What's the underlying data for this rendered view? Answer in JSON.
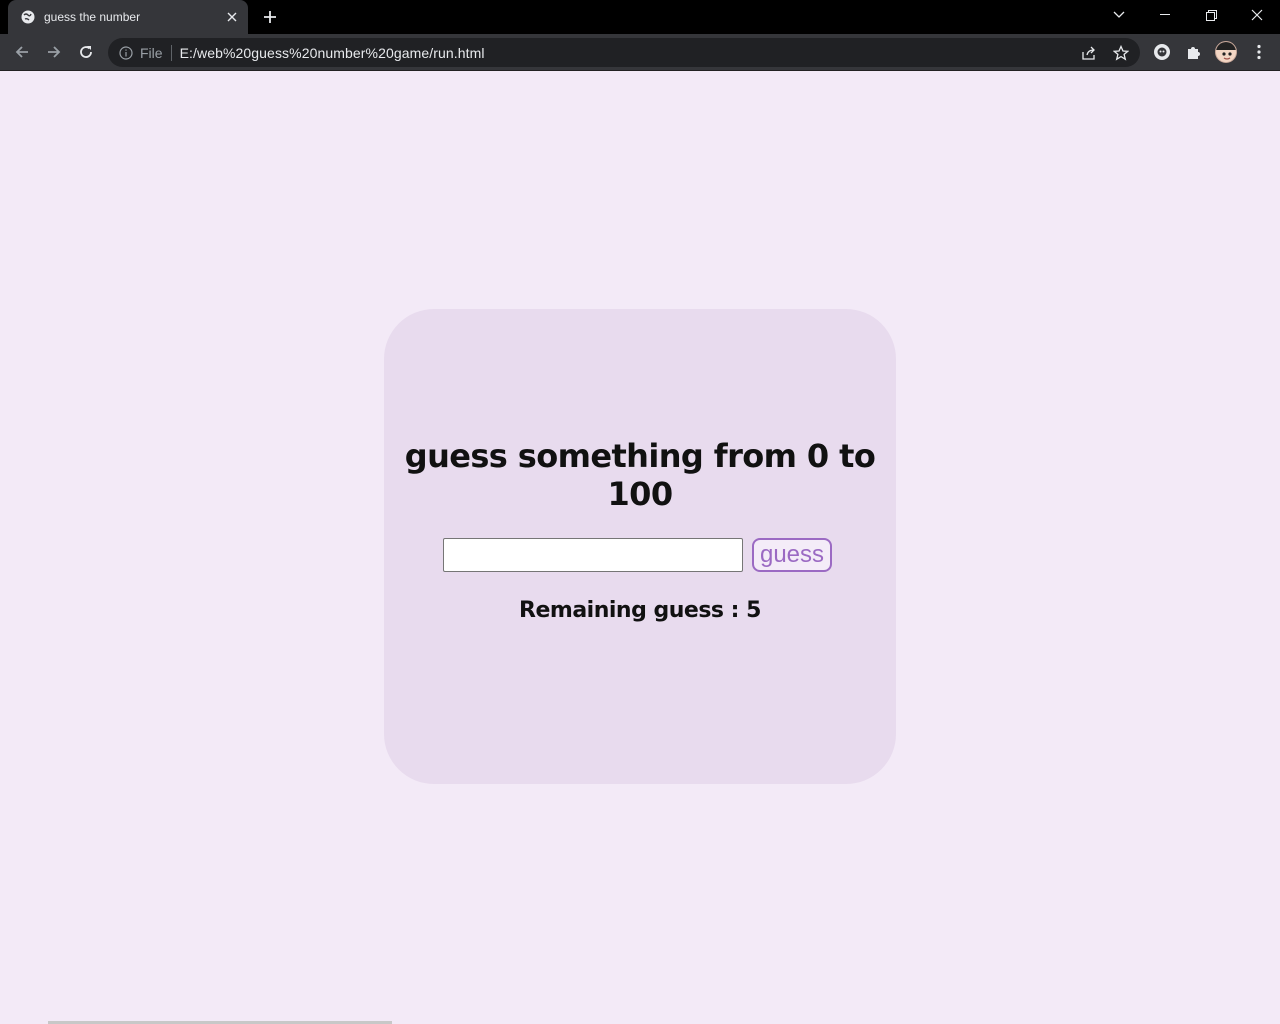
{
  "browser": {
    "tab_title": "guess the number",
    "url_scheme": "File",
    "url": "E:/web%20guess%20number%20game/run.html"
  },
  "game": {
    "heading": "guess something from 0 to 100",
    "input_value": "",
    "input_placeholder": "",
    "guess_button_label": "guess",
    "remaining_label": "Remaining guess : 5"
  },
  "colors": {
    "page_background": "#f3eaf7",
    "card_background": "#e8dbee",
    "button_accent": "#9b6ac3"
  }
}
